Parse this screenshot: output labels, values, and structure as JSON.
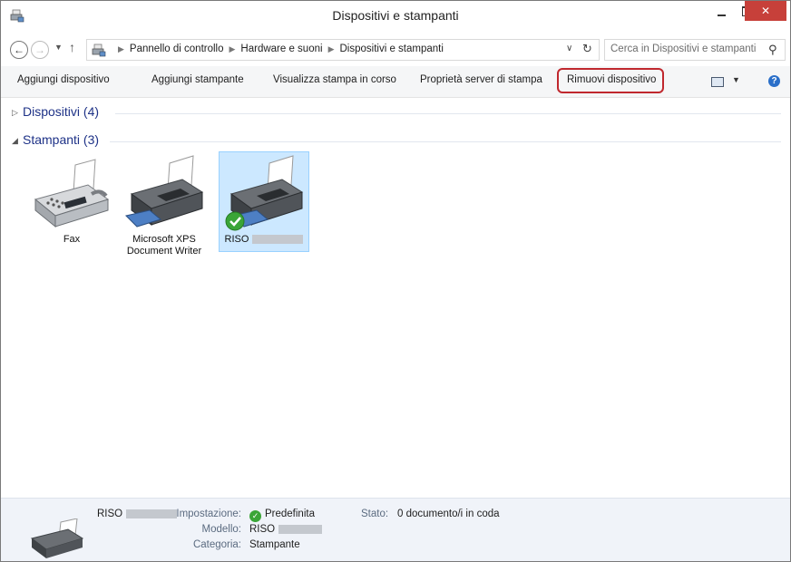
{
  "window": {
    "title": "Dispositivi e stampanti"
  },
  "titlebar": {
    "minimize_symbol": "",
    "close_symbol": "✕"
  },
  "address": {
    "crumbs": [
      "Pannello di controllo",
      "Hardware e suoni",
      "Dispositivi e stampanti"
    ],
    "search_placeholder": "Cerca in Dispositivi e stampanti"
  },
  "commands": {
    "add_device": "Aggiungi dispositivo",
    "add_printer": "Aggiungi stampante",
    "see_printing": "Visualizza stampa in corso",
    "print_server": "Proprietà server di stampa",
    "remove_device": "Rimuovi dispositivo"
  },
  "groups": {
    "devices": {
      "title": "Dispositivi (4)",
      "expanded": false
    },
    "printers": {
      "title": "Stampanti (3)",
      "expanded": true
    }
  },
  "printers": [
    {
      "label_line1": "Fax",
      "label_line2": "",
      "selected": false,
      "default": false
    },
    {
      "label_line1": "Microsoft XPS",
      "label_line2": "Document Writer",
      "selected": false,
      "default": false
    },
    {
      "label_line1": "RISO",
      "label_line2": "",
      "selected": true,
      "default": true
    }
  ],
  "details": {
    "name": "RISO",
    "setting_label": "Impostazione:",
    "setting_value": "Predefinita",
    "model_label": "Modello:",
    "model_value": "RISO",
    "category_label": "Categoria:",
    "category_value": "Stampante",
    "status_label": "Stato:",
    "status_value": "0 documento/i in coda"
  },
  "colors": {
    "accent_link": "#1e3287",
    "selection_bg": "#cce8ff",
    "highlight_border": "#c0282e",
    "close_button": "#c7403a",
    "default_check": "#3aa537"
  }
}
